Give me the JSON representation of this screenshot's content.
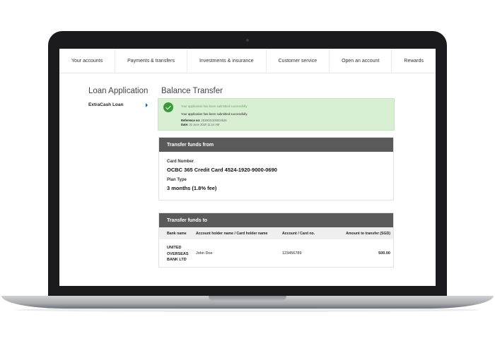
{
  "nav": {
    "items": [
      "Your accounts",
      "Payments & transfers",
      "Investments & insurance",
      "Customer service",
      "Open an account",
      "Rewards"
    ]
  },
  "sidebar": {
    "title": "Loan Application",
    "items": [
      {
        "label": "ExtraCash Loan",
        "selected": true
      }
    ]
  },
  "main": {
    "title": "Balance Transfer",
    "success": {
      "heading": "Your application has been submitted successfully",
      "message": "Your application has been submitted successfully.",
      "reference_label": "Reference no:",
      "reference_value": "2019031100004526",
      "date_label": "Date:",
      "date_value": "30 June 2020 11:14 AM",
      "color": "#3a9a3a"
    },
    "transfer_from": {
      "title": "Transfer funds from",
      "card_label": "Card Number",
      "card_value": "OCBC 365 Credit Card 4524-1920-9000-0690",
      "plan_label": "Plan Type",
      "plan_value": "3 months (1.8% fee)"
    },
    "transfer_to": {
      "title": "Transfer funds to",
      "columns": [
        "Bank name",
        "Account holder name / Card holder name",
        "Account / Card no.",
        "Amount to transfer (SGD)"
      ],
      "rows": [
        {
          "bank": "UNITED OVERSEAS BANK LTD",
          "holder": "John Doe",
          "account": "123456789",
          "amount": "500.00"
        }
      ]
    }
  },
  "colors": {
    "panel_header": "#5a5a5a",
    "success_bg": "#d9efd4",
    "accent": "#1a66a8"
  }
}
